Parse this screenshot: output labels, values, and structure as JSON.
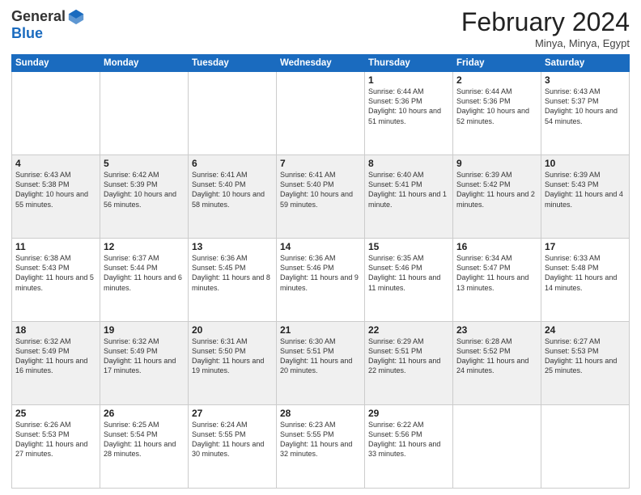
{
  "header": {
    "logo": {
      "line1": "General",
      "line2": "Blue"
    },
    "title": "February 2024",
    "subtitle": "Minya, Minya, Egypt"
  },
  "weekdays": [
    "Sunday",
    "Monday",
    "Tuesday",
    "Wednesday",
    "Thursday",
    "Friday",
    "Saturday"
  ],
  "weeks": [
    [
      {
        "day": "",
        "info": ""
      },
      {
        "day": "",
        "info": ""
      },
      {
        "day": "",
        "info": ""
      },
      {
        "day": "",
        "info": ""
      },
      {
        "day": "1",
        "info": "Sunrise: 6:44 AM\nSunset: 5:36 PM\nDaylight: 10 hours\nand 51 minutes."
      },
      {
        "day": "2",
        "info": "Sunrise: 6:44 AM\nSunset: 5:36 PM\nDaylight: 10 hours\nand 52 minutes."
      },
      {
        "day": "3",
        "info": "Sunrise: 6:43 AM\nSunset: 5:37 PM\nDaylight: 10 hours\nand 54 minutes."
      }
    ],
    [
      {
        "day": "4",
        "info": "Sunrise: 6:43 AM\nSunset: 5:38 PM\nDaylight: 10 hours\nand 55 minutes."
      },
      {
        "day": "5",
        "info": "Sunrise: 6:42 AM\nSunset: 5:39 PM\nDaylight: 10 hours\nand 56 minutes."
      },
      {
        "day": "6",
        "info": "Sunrise: 6:41 AM\nSunset: 5:40 PM\nDaylight: 10 hours\nand 58 minutes."
      },
      {
        "day": "7",
        "info": "Sunrise: 6:41 AM\nSunset: 5:40 PM\nDaylight: 10 hours\nand 59 minutes."
      },
      {
        "day": "8",
        "info": "Sunrise: 6:40 AM\nSunset: 5:41 PM\nDaylight: 11 hours\nand 1 minute."
      },
      {
        "day": "9",
        "info": "Sunrise: 6:39 AM\nSunset: 5:42 PM\nDaylight: 11 hours\nand 2 minutes."
      },
      {
        "day": "10",
        "info": "Sunrise: 6:39 AM\nSunset: 5:43 PM\nDaylight: 11 hours\nand 4 minutes."
      }
    ],
    [
      {
        "day": "11",
        "info": "Sunrise: 6:38 AM\nSunset: 5:43 PM\nDaylight: 11 hours\nand 5 minutes."
      },
      {
        "day": "12",
        "info": "Sunrise: 6:37 AM\nSunset: 5:44 PM\nDaylight: 11 hours\nand 6 minutes."
      },
      {
        "day": "13",
        "info": "Sunrise: 6:36 AM\nSunset: 5:45 PM\nDaylight: 11 hours\nand 8 minutes."
      },
      {
        "day": "14",
        "info": "Sunrise: 6:36 AM\nSunset: 5:46 PM\nDaylight: 11 hours\nand 9 minutes."
      },
      {
        "day": "15",
        "info": "Sunrise: 6:35 AM\nSunset: 5:46 PM\nDaylight: 11 hours\nand 11 minutes."
      },
      {
        "day": "16",
        "info": "Sunrise: 6:34 AM\nSunset: 5:47 PM\nDaylight: 11 hours\nand 13 minutes."
      },
      {
        "day": "17",
        "info": "Sunrise: 6:33 AM\nSunset: 5:48 PM\nDaylight: 11 hours\nand 14 minutes."
      }
    ],
    [
      {
        "day": "18",
        "info": "Sunrise: 6:32 AM\nSunset: 5:49 PM\nDaylight: 11 hours\nand 16 minutes."
      },
      {
        "day": "19",
        "info": "Sunrise: 6:32 AM\nSunset: 5:49 PM\nDaylight: 11 hours\nand 17 minutes."
      },
      {
        "day": "20",
        "info": "Sunrise: 6:31 AM\nSunset: 5:50 PM\nDaylight: 11 hours\nand 19 minutes."
      },
      {
        "day": "21",
        "info": "Sunrise: 6:30 AM\nSunset: 5:51 PM\nDaylight: 11 hours\nand 20 minutes."
      },
      {
        "day": "22",
        "info": "Sunrise: 6:29 AM\nSunset: 5:51 PM\nDaylight: 11 hours\nand 22 minutes."
      },
      {
        "day": "23",
        "info": "Sunrise: 6:28 AM\nSunset: 5:52 PM\nDaylight: 11 hours\nand 24 minutes."
      },
      {
        "day": "24",
        "info": "Sunrise: 6:27 AM\nSunset: 5:53 PM\nDaylight: 11 hours\nand 25 minutes."
      }
    ],
    [
      {
        "day": "25",
        "info": "Sunrise: 6:26 AM\nSunset: 5:53 PM\nDaylight: 11 hours\nand 27 minutes."
      },
      {
        "day": "26",
        "info": "Sunrise: 6:25 AM\nSunset: 5:54 PM\nDaylight: 11 hours\nand 28 minutes."
      },
      {
        "day": "27",
        "info": "Sunrise: 6:24 AM\nSunset: 5:55 PM\nDaylight: 11 hours\nand 30 minutes."
      },
      {
        "day": "28",
        "info": "Sunrise: 6:23 AM\nSunset: 5:55 PM\nDaylight: 11 hours\nand 32 minutes."
      },
      {
        "day": "29",
        "info": "Sunrise: 6:22 AM\nSunset: 5:56 PM\nDaylight: 11 hours\nand 33 minutes."
      },
      {
        "day": "",
        "info": ""
      },
      {
        "day": "",
        "info": ""
      }
    ]
  ]
}
